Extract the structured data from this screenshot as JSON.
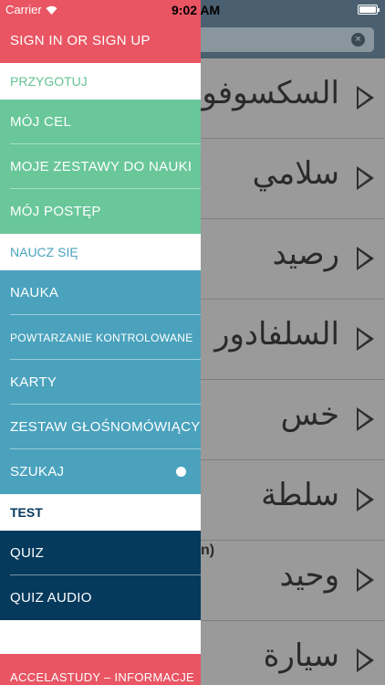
{
  "status_bar": {
    "carrier": "Carrier",
    "time": "9:02 AM",
    "battery_percent": 100
  },
  "drawer": {
    "sign_in": "SIGN IN OR SIGN UP",
    "section_prepare": "PRZYGOTUJ",
    "prepare_items": [
      "MÓJ CEL",
      "MOJE ZESTAWY DO NAUKI",
      "MÓJ POSTĘP"
    ],
    "section_learn": "NAUCZ SIĘ",
    "learn_items": [
      "NAUKA",
      "POWTARZANIE KONTROLOWANE",
      "KARTY",
      "ZESTAW GŁOŚNOMÓWIĄCY",
      "SZUKAJ"
    ],
    "section_test": "TEST",
    "test_items": [
      "QUIZ",
      "QUIZ AUDIO"
    ],
    "about": "ACCELASTUDY – INFORMACJE"
  },
  "background": {
    "words": [
      "السكسوفون",
      "سلامي",
      "رصيد",
      "السلفادور",
      "خس",
      "سلطة",
      "وحيد",
      "سيارة"
    ],
    "fragment": "n)"
  },
  "colors": {
    "red": "#e95563",
    "green": "#69c79a",
    "blue": "#4aa2bd",
    "navy": "#063a5d"
  }
}
